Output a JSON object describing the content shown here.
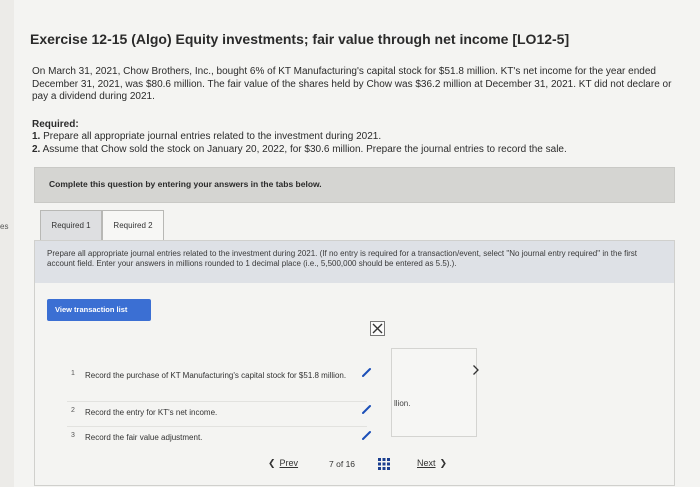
{
  "page": {
    "title": "Exercise 12-15 (Algo) Equity investments; fair value through net income [LO12-5]",
    "intro": "On March 31, 2021, Chow Brothers, Inc., bought 6% of KT Manufacturing's capital stock for $51.8 million. KT's net income for the year ended December 31, 2021, was $80.6 million. The fair value of the shares held by Chow was $36.2 million at December 31, 2021. KT did not declare or pay a dividend during 2021.",
    "required_heading": "Required:",
    "required_items": [
      {
        "num": "1.",
        "text": "Prepare all appropriate journal entries related to the investment during 2021."
      },
      {
        "num": "2.",
        "text": "Assume that Chow sold the stock on January 20, 2022, for $30.6 million. Prepare the journal entries to record the sale."
      }
    ]
  },
  "left_edge_text": "es",
  "complete_bar": "Complete this question by entering your answers in the tabs below.",
  "tabs": [
    {
      "label": "Required 1",
      "active": true
    },
    {
      "label": "Required 2",
      "active": false
    }
  ],
  "instructions": "Prepare all appropriate journal entries related to the investment during 2021. (If no entry is required for a transaction/event, select \"No journal entry required\" in the first account field. Enter your answers in millions rounded to 1 decimal place (i.e., 5,500,000 should be entered as 5.5).).",
  "view_button": "View transaction list",
  "transactions": [
    {
      "num": "1",
      "text": "Record the purchase of KT Manufacturing's capital stock for $51.8 million."
    },
    {
      "num": "2",
      "text": "Record the entry for KT's net income."
    },
    {
      "num": "3",
      "text": "Record the fair value adjustment."
    }
  ],
  "side_panel_text": "llion.",
  "nav": {
    "prev_label": "Prev",
    "page_current": "7",
    "page_of": "of",
    "page_total": "16",
    "next_label": "Next"
  },
  "colors": {
    "accent": "#3b6fd3",
    "edit_icon": "#1b4fb8",
    "instruction_bg": "#dee1e6"
  }
}
